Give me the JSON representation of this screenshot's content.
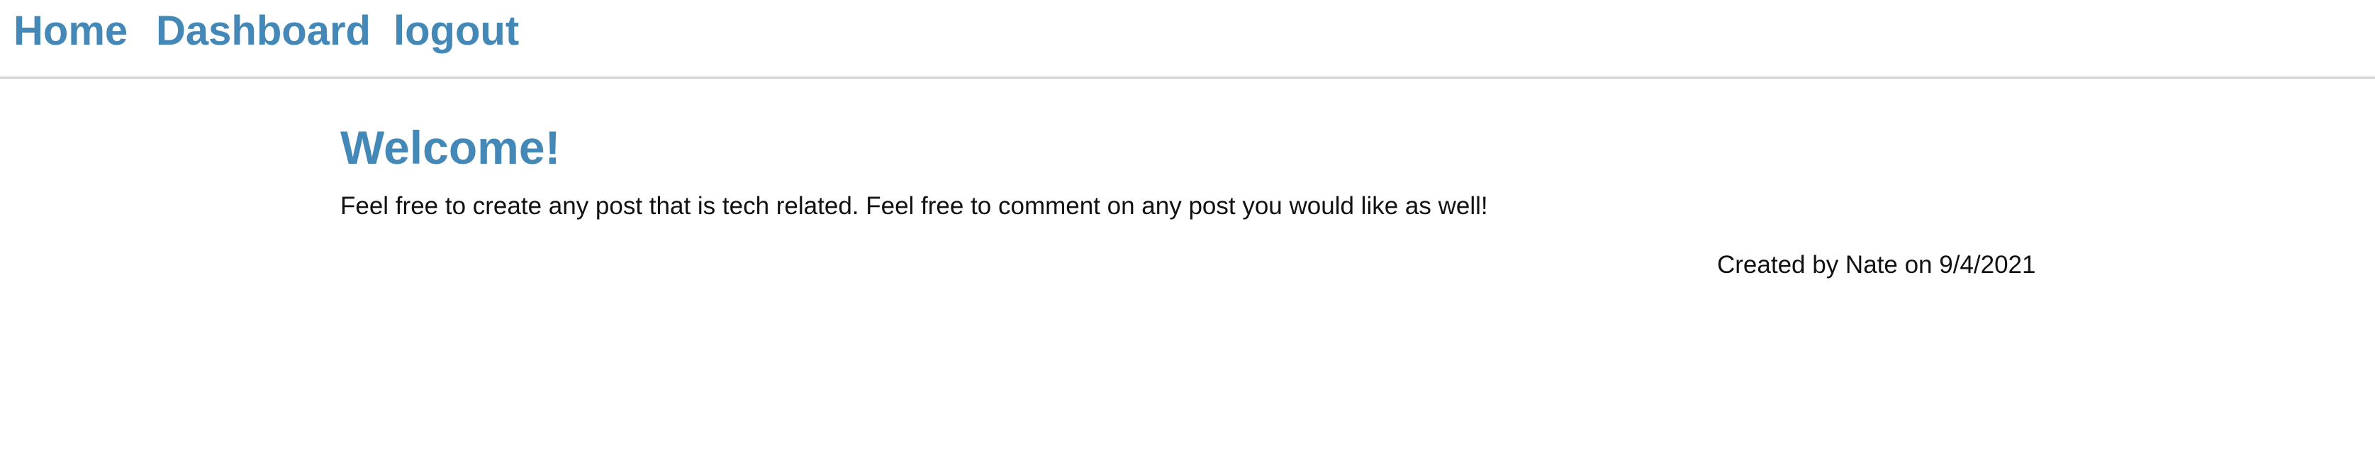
{
  "nav": {
    "links": [
      {
        "label": "Home"
      },
      {
        "label": "Dashboard"
      },
      {
        "label": "logout"
      }
    ]
  },
  "post": {
    "title": "Welcome!",
    "body": "Feel free to create any post that is tech related. Feel free to comment on any post you would like as well!",
    "meta": "Created by Nate on 9/4/2021"
  },
  "colors": {
    "link": "#4488b8",
    "text": "#111111",
    "divider": "#d3d3d3",
    "background": "#ffffff"
  }
}
